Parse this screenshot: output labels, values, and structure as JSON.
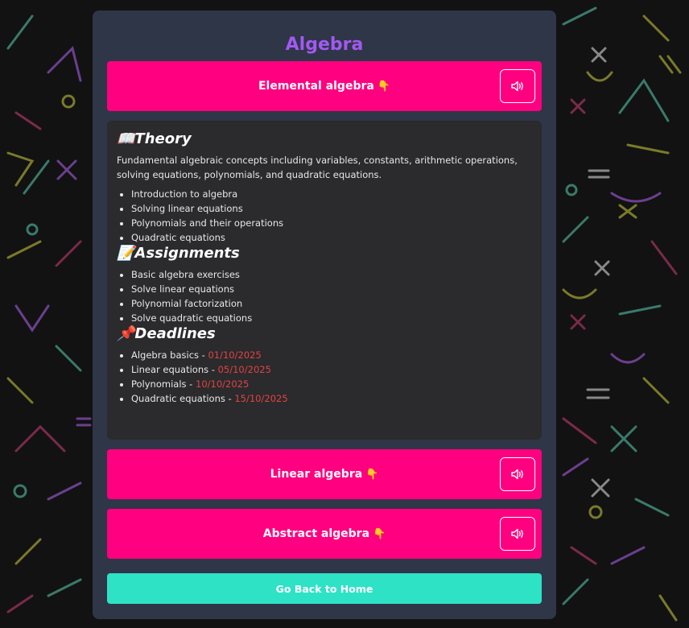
{
  "page": {
    "title": "Algebra"
  },
  "sections": [
    {
      "label": "Elemental algebra",
      "expanded": true,
      "theory": {
        "heading": "Theory",
        "heading_icon": "📖",
        "description": "Fundamental algebraic concepts including variables, constants, arithmetic operations, solving equations, polynomials, and quadratic equations.",
        "items": [
          "Introduction to algebra",
          "Solving linear equations",
          "Polynomials and their operations",
          "Quadratic equations"
        ]
      },
      "assignments": {
        "heading": "Assignments",
        "heading_icon": "📝",
        "items": [
          "Basic algebra exercises",
          "Solve linear equations",
          "Polynomial factorization",
          "Solve quadratic equations"
        ]
      },
      "deadlines": {
        "heading": "Deadlines",
        "heading_icon": "📌",
        "items": [
          {
            "name": "Algebra basics",
            "date": "01/10/2025"
          },
          {
            "name": "Linear equations",
            "date": "05/10/2025"
          },
          {
            "name": "Polynomials",
            "date": "10/10/2025"
          },
          {
            "name": "Quadratic equations",
            "date": "15/10/2025"
          }
        ]
      }
    },
    {
      "label": "Linear algebra",
      "expanded": false
    },
    {
      "label": "Abstract algebra",
      "expanded": false
    }
  ],
  "home_button": "Go Back to Home",
  "icons": {
    "expand": "pointing-down-hand-icon",
    "speak": "speaker-icon"
  },
  "colors": {
    "title": "#a259f2",
    "accordion": "#ff0080",
    "home_button": "#2ee2c6",
    "date": "#e04444",
    "panel": "#2f3647"
  }
}
